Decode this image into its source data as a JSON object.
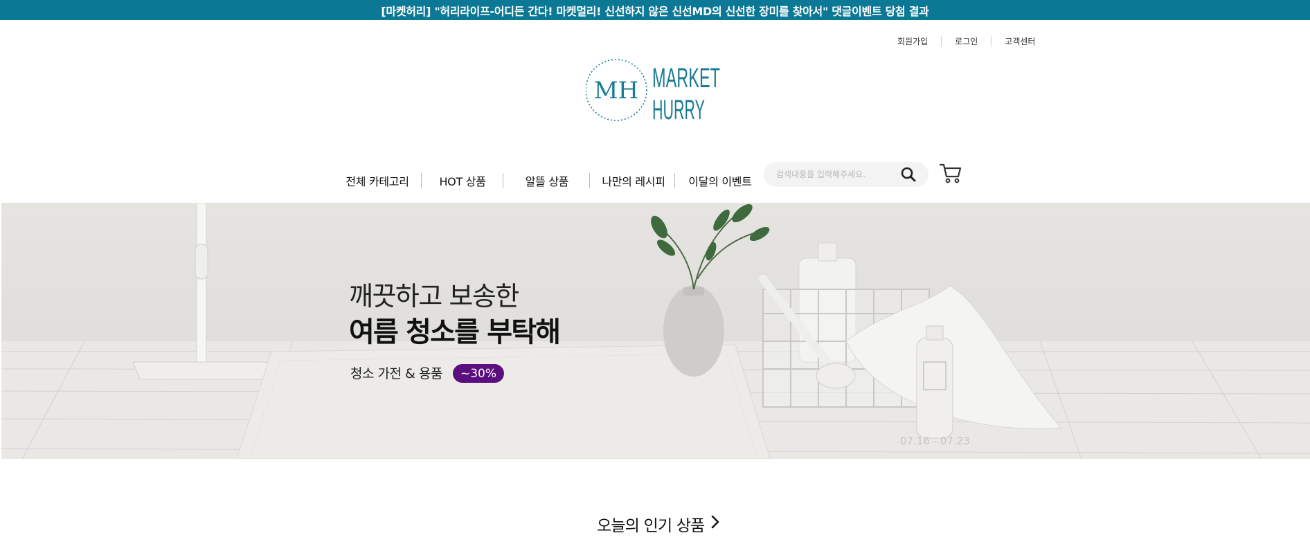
{
  "announcement": {
    "text": "[마켓허리] \"허리라이프-어디든 간다! 마켓멀리! 신선하지 않은 신선MD의 신선한 장미를 찾아서\" 댓글이벤트 당첨 결과"
  },
  "util_menu": {
    "signup": "회원가입",
    "login": "로그인",
    "customer_center": "고객센터"
  },
  "logo": {
    "monogram": "MH",
    "line1": "MARKET",
    "line2": "HURRY",
    "color": "#1a7b95"
  },
  "nav": {
    "items": [
      {
        "label": "전체 카테고리"
      },
      {
        "label": "HOT 상품"
      },
      {
        "label": "알뜰 상품"
      },
      {
        "label": "나만의 레시피"
      },
      {
        "label": "이달의 이벤트"
      }
    ]
  },
  "search": {
    "placeholder": "검색내용을 입력해주세요.",
    "icon": "search-icon"
  },
  "cart": {
    "icon": "cart-icon"
  },
  "banner": {
    "line1": "깨끗하고 보송한",
    "line2": "여름 청소를 부탁해",
    "subtitle": "청소 가전 & 용품",
    "badge": "~30%",
    "badge_color": "#5b0e7d",
    "date_range": "07.16 - 07.23"
  },
  "popular": {
    "title": "오늘의 인기 상품",
    "icon": "chevron-right-icon"
  }
}
